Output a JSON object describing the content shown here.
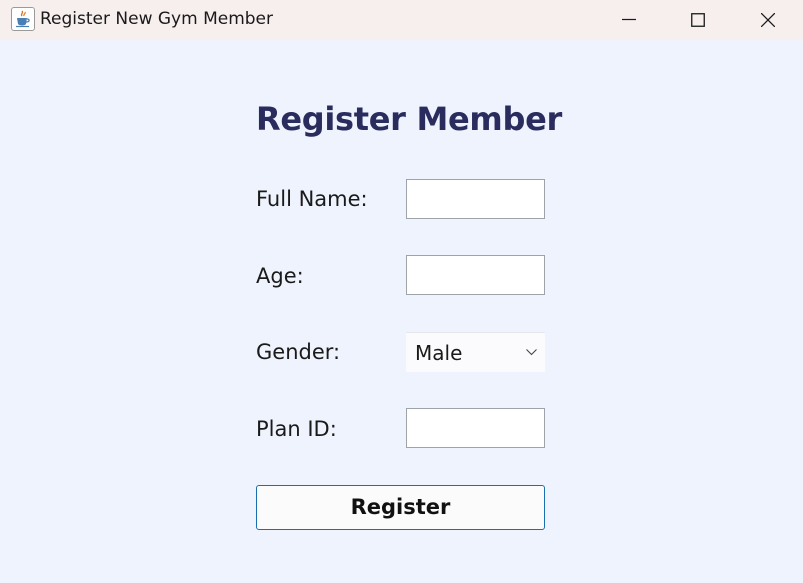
{
  "window": {
    "title": "Register New Gym Member",
    "app_icon": "java-cup-icon",
    "controls": [
      "minimize-icon",
      "maximize-icon",
      "close-icon"
    ]
  },
  "form": {
    "heading": "Register Member",
    "fields": {
      "full_name": {
        "label": "Full Name:",
        "value": ""
      },
      "age": {
        "label": "Age:",
        "value": ""
      },
      "gender": {
        "label": "Gender:",
        "selected": "Male"
      },
      "plan_id": {
        "label": "Plan ID:",
        "value": ""
      }
    },
    "submit_label": "Register"
  },
  "colors": {
    "background": "#eff3fd",
    "titlebar": "#f7eeee",
    "heading": "#2a2c5e",
    "button_border": "#1a6fb0"
  }
}
